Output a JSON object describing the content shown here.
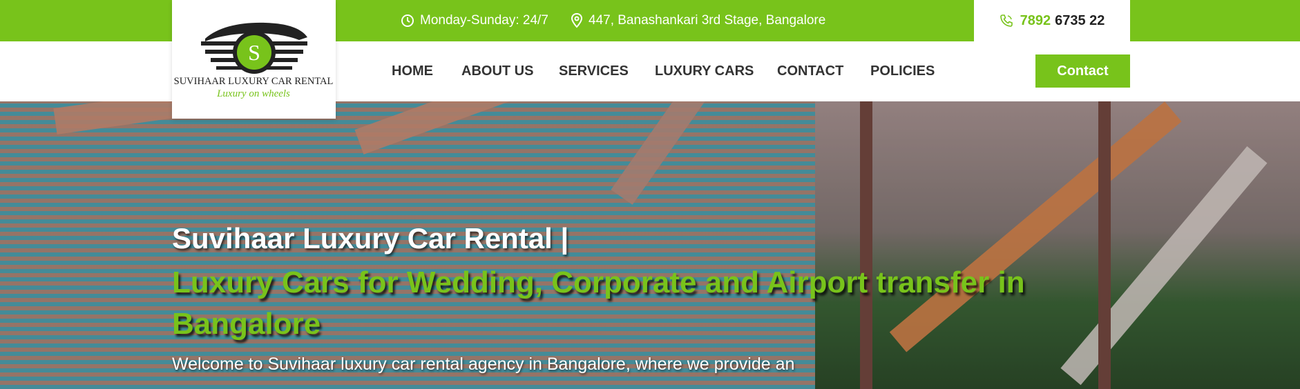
{
  "topbar": {
    "hours": "Monday-Sunday: 24/7",
    "address": "447, Banashankari 3rd Stage, Bangalore",
    "phone_prefix": "7892",
    "phone_rest": "6735 22"
  },
  "logo": {
    "brand": "SUVIHAAR LUXURY CAR RENTAL",
    "tagline": "Luxury on wheels",
    "letter": "S"
  },
  "nav": {
    "items": [
      "HOME",
      "ABOUT US",
      "SERVICES",
      "LUXURY CARS",
      "CONTACT",
      "POLICIES"
    ],
    "cta_label": "Contact"
  },
  "hero": {
    "title": "Suvihaar Luxury Car Rental |",
    "subtitle": "Luxury Cars for Wedding, Corporate and Airport transfer in Bangalore",
    "intro": "Welcome to Suvihaar luxury car rental agency in Bangalore, where we provide an"
  },
  "icons": {
    "hours": "clock-icon",
    "address": "map-pin-icon",
    "phone": "phone-icon"
  },
  "colors": {
    "accent": "#78c31b",
    "text_dark": "#333333",
    "white": "#ffffff"
  }
}
